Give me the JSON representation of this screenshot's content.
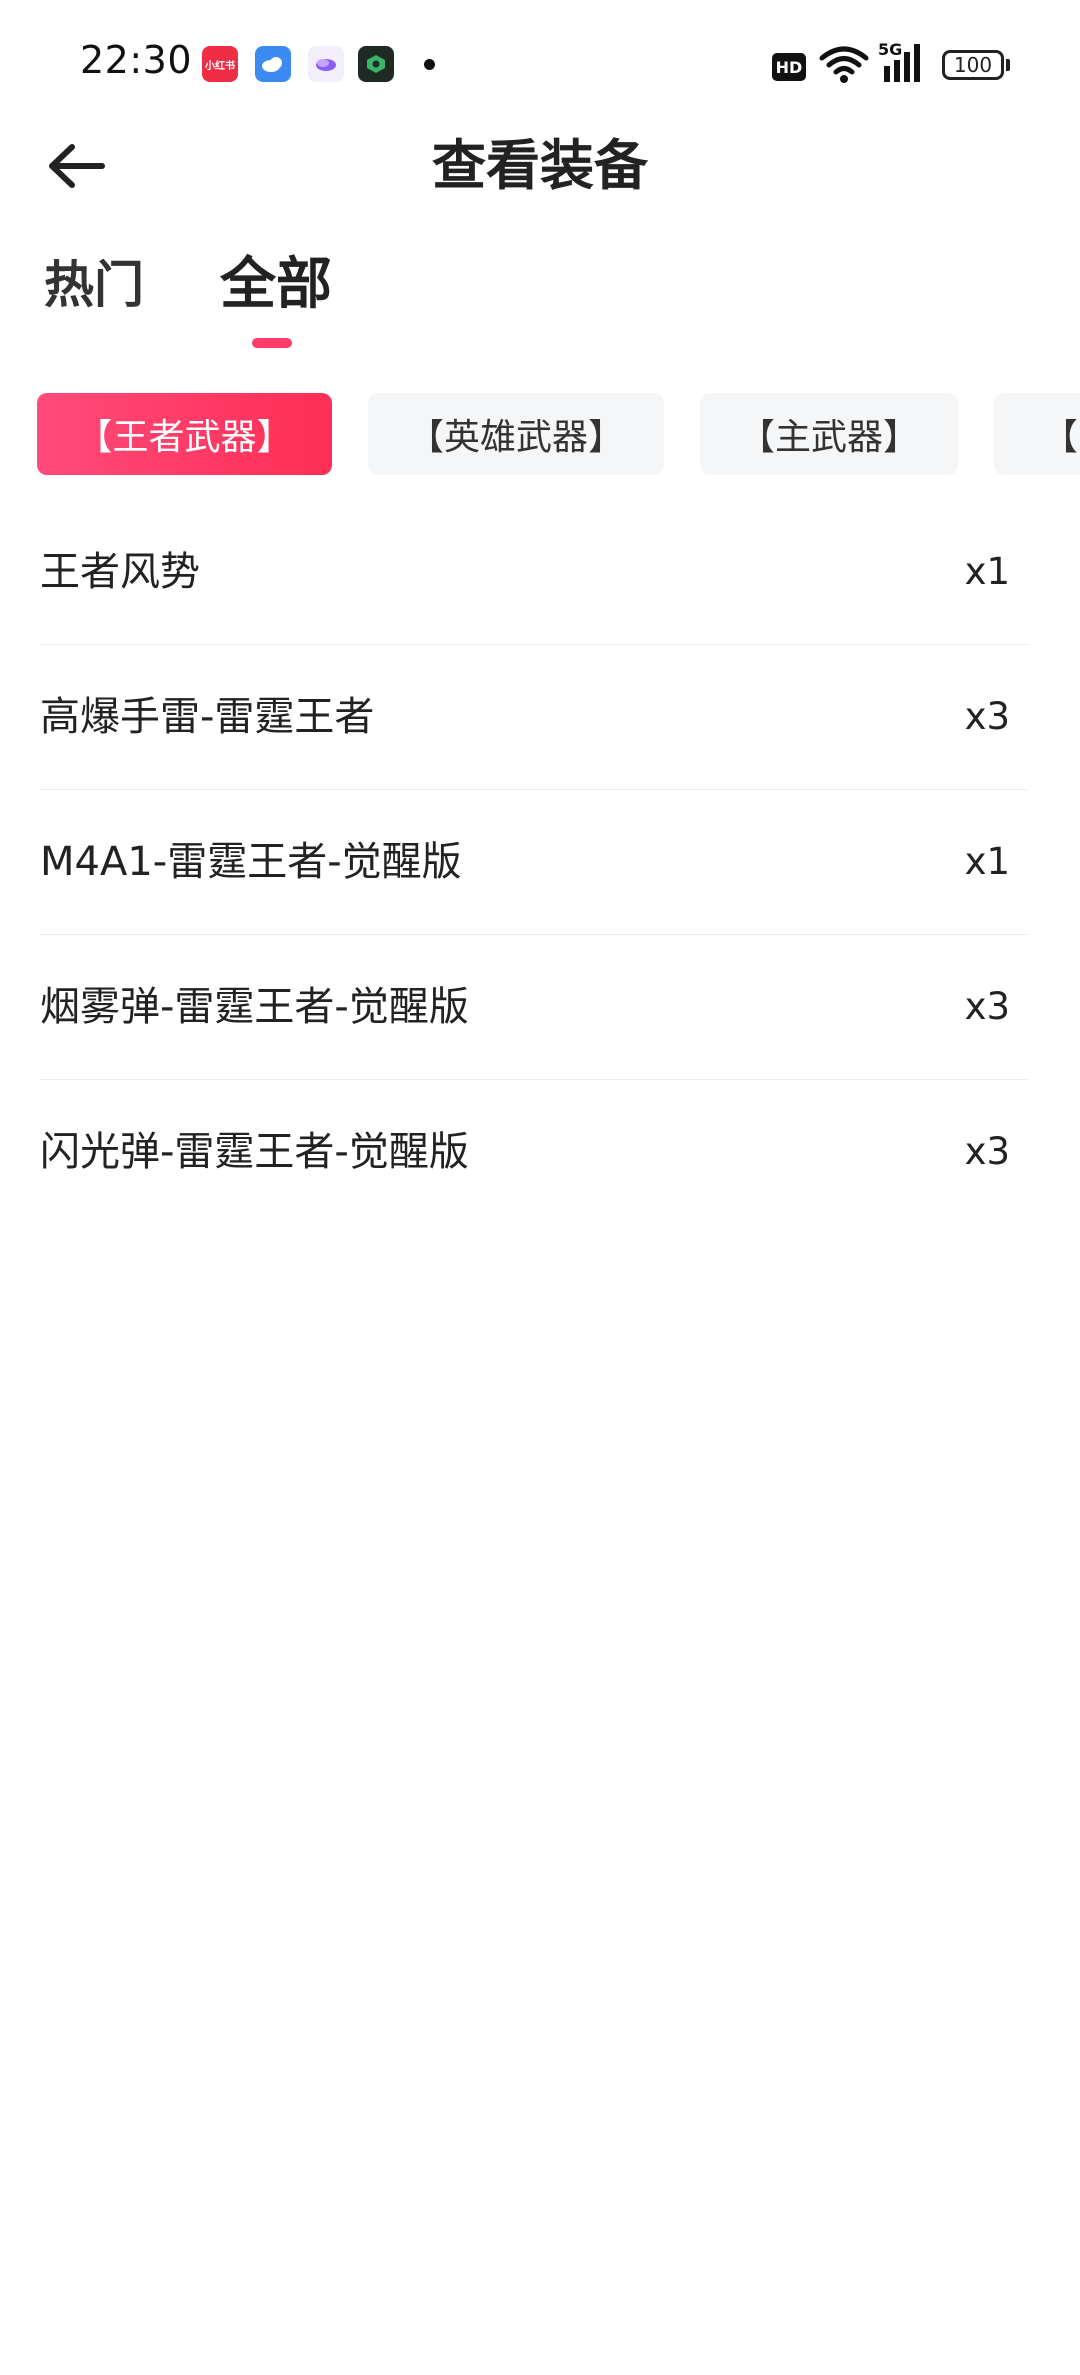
{
  "status_bar": {
    "time": "22:30",
    "app_icons": [
      "xiaohongshu-icon",
      "weather-icon",
      "app-icon",
      "game-app-icon"
    ],
    "app_icon_texts": [
      "小红书"
    ],
    "hd_label": "HD",
    "network_label": "5G",
    "battery": "100"
  },
  "header": {
    "title": "查看装备",
    "back_icon": "back-arrow-icon"
  },
  "tabs": [
    {
      "label": "热门",
      "active": false
    },
    {
      "label": "全部",
      "active": true
    }
  ],
  "chips": [
    {
      "label": "【王者武器】",
      "active": true
    },
    {
      "label": "【英雄武器】",
      "active": false
    },
    {
      "label": "【主武器】",
      "active": false
    },
    {
      "label": "【副",
      "active": false
    }
  ],
  "items": [
    {
      "name": "王者风势",
      "qty": "x1"
    },
    {
      "name": "高爆手雷-雷霆王者",
      "qty": "x3"
    },
    {
      "name": "M4A1-雷霆王者-觉醒版",
      "qty": "x1"
    },
    {
      "name": "烟雾弹-雷霆王者-觉醒版",
      "qty": "x3"
    },
    {
      "name": "闪光弹-雷霆王者-觉醒版",
      "qty": "x3"
    }
  ],
  "colors": {
    "accent": "#ff3d6b",
    "chip_active_start": "#ff4a7a",
    "chip_active_end": "#ff2e55",
    "chip_bg": "#f4f6f8"
  }
}
